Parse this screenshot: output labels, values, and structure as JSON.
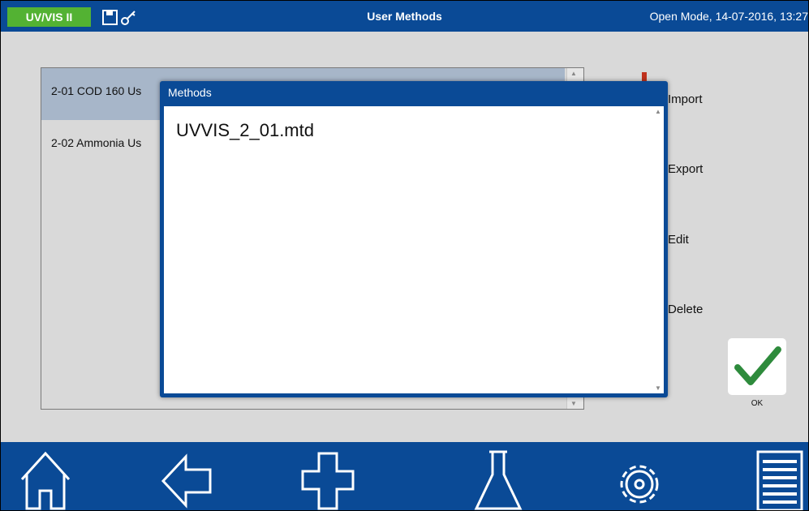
{
  "header": {
    "app_name": "UV/VIS II",
    "icons": [
      "save-icon",
      "key-icon"
    ],
    "title": "User Methods",
    "status": "Open Mode, 14-07-2016, 13:27"
  },
  "method_list": {
    "items": [
      {
        "label": "2-01 COD 160 Us",
        "selected": true
      },
      {
        "label": "2-02 Ammonia Us",
        "selected": false
      }
    ]
  },
  "actions": {
    "import_label": "Import",
    "export_label": "Export",
    "edit_label": "Edit",
    "delete_label": "Delete",
    "ok_label": "OK"
  },
  "dialog": {
    "title": "Methods",
    "files": [
      "UVVIS_2_01.mtd"
    ]
  },
  "footer": {
    "buttons": [
      "home-icon",
      "back-arrow-icon",
      "plus-icon",
      "flask-icon",
      "gear-icon",
      "menu-icon"
    ]
  },
  "colors": {
    "header_blue": "#0a4a96",
    "badge_green": "#53b233",
    "selected_row": "#a7b6c9",
    "ok_check_green": "#2e8b3c",
    "background": "#d9d9d9"
  }
}
